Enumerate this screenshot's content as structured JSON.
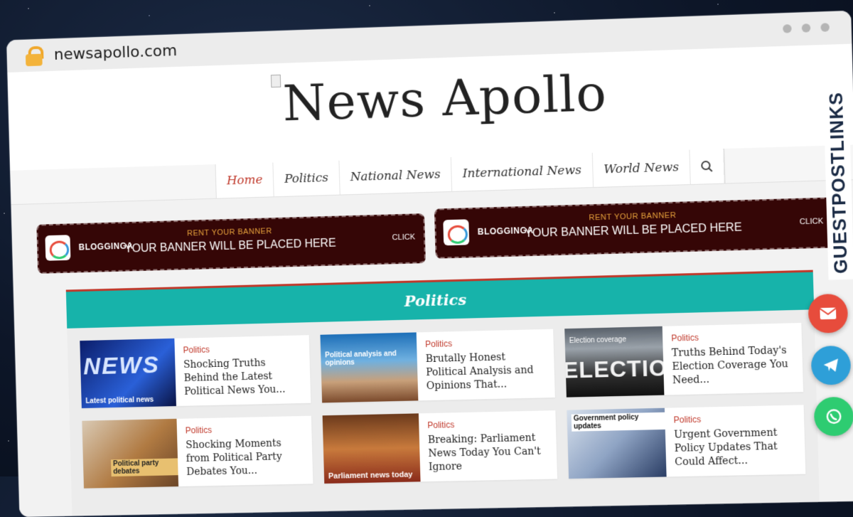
{
  "browser": {
    "url": "newsapollo.com"
  },
  "site": {
    "title": "News Apollo"
  },
  "nav": {
    "items": [
      "Home",
      "Politics",
      "National News",
      "International News",
      "World News"
    ]
  },
  "banners": [
    {
      "brand": "BLOGGINGA",
      "rent": "RENT YOUR BANNER",
      "main": "YOUR BANNER WILL BE PLACED HERE",
      "click": "CLICK"
    },
    {
      "brand": "BLOGGINGA",
      "rent": "RENT YOUR BANNER",
      "main": "YOUR BANNER WILL BE PLACED HERE",
      "click": "CLICK"
    }
  ],
  "section": {
    "title": "Politics"
  },
  "articles": [
    {
      "category": "Politics",
      "title": "Shocking Truths Behind the Latest Political News You...",
      "thumb_text": "Latest political news"
    },
    {
      "category": "Politics",
      "title": "Brutally Honest Political Analysis and Opinions That...",
      "thumb_text": "Political analysis and opinions"
    },
    {
      "category": "Politics",
      "title": "Truths Behind Today's Election Coverage You Need...",
      "thumb_text": "Election coverage"
    },
    {
      "category": "Politics",
      "title": "Shocking Moments from Political Party Debates You...",
      "thumb_text": "Political party debates"
    },
    {
      "category": "Politics",
      "title": "Breaking: Parliament News Today You Can't Ignore",
      "thumb_text": "Parliament news today"
    },
    {
      "category": "Politics",
      "title": "Urgent Government Policy Updates That Could Affect...",
      "thumb_text": "Government policy updates"
    }
  ],
  "thumb_big": {
    "news": "NEWS",
    "election": "ELECTIO"
  },
  "side_brand": "GUESTPOSTLINKS",
  "fab": {
    "email": "email-icon",
    "telegram": "telegram-icon",
    "whatsapp": "whatsapp-icon"
  }
}
